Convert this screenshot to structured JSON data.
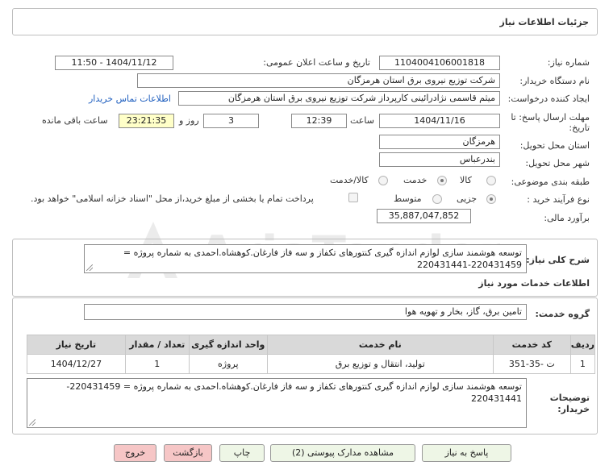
{
  "header": {
    "title": "جزئیات اطلاعات نیاز"
  },
  "form": {
    "need_number_label": "شماره نیاز:",
    "need_number": "1104004106001818",
    "announce_label": "تاریخ و ساعت اعلان عمومی:",
    "announce_value": "1404/11/12 - 11:50",
    "buyer_org_label": "نام دستگاه خریدار:",
    "buyer_org": "شرکت توزیع نیروی برق استان هرمزگان",
    "creator_label": "ایجاد کننده درخواست:",
    "creator": "میثم قاسمی نژادرائینی کارپرداز شرکت توزیع نیروی برق استان هرمزگان",
    "contact_link": "اطلاعات تماس خریدار",
    "deadline_label_1": "مهلت ارسال پاسخ: تا",
    "deadline_label_2": "تاریخ:",
    "deadline_date": "1404/11/16",
    "time_label": "ساعت",
    "deadline_time": "12:39",
    "days_value": "3",
    "days_label": "روز و",
    "remaining_time": "23:21:35",
    "remaining_label": "ساعت باقی مانده",
    "province_label": "استان محل تحویل:",
    "province": "هرمزگان",
    "city_label": "شهر محل تحویل:",
    "city": "بندرعباس",
    "category_label": "طبقه بندی موضوعی:",
    "category_options": [
      "کالا",
      "خدمت",
      "کالا/خدمت"
    ],
    "category_selected": "خدمت",
    "process_label": "نوع فرآیند خرید :",
    "process_options": [
      "جزیی",
      "متوسط"
    ],
    "process_selected": "جزیی",
    "payment_note": "پرداخت تمام یا بخشی از مبلغ خرید،از محل \"اسناد خزانه اسلامی\" خواهد بود.",
    "estimate_label": "برآورد مالی:",
    "estimate": "35,887,047,852"
  },
  "summary": {
    "label": "شرح کلی نیاز:",
    "text": "توسعه هوشمند سازی لوازم اندازه گیری کنتورهای تکفاز و سه فاز  فارغان.کوهشاه.احمدی به شماره پروژه = 220431459-220431441"
  },
  "services": {
    "section_title": "اطلاعات خدمات مورد نیاز",
    "group_label": "گروه خدمت:",
    "group_value": "تامین برق، گاز، بخار و تهویه هوا",
    "columns": [
      "ردیف",
      "کد خدمت",
      "نام خدمت",
      "واحد اندازه گیری",
      "تعداد / مقدار",
      "تاریخ نیاز"
    ],
    "rows": [
      [
        "1",
        "ت -35-351",
        "تولید، انتقال و توزیع برق",
        "پروژه",
        "1",
        "1404/12/27"
      ]
    ]
  },
  "buyer_notes": {
    "label_1": "توضیحات",
    "label_2": "خریدار:",
    "text": "توسعه هوشمند سازی لوازم اندازه گیری کنتورهای تکفاز و سه فاز  فارغان.کوهشاه.احمدی به شماره پروژه = 220431459-220431441"
  },
  "buttons": {
    "reply": "پاسخ به نیاز",
    "attachments": "مشاهده مدارک پیوستی (2)",
    "print": "چاپ",
    "back": "بازگشت",
    "exit": "خروج"
  },
  "colors": {
    "header_border": "#bfbfbf",
    "yellow_field": "#ffffc8",
    "table_header": "#d9d9d9",
    "green_button": "#eef6e6",
    "red_button": "#f6c6c6",
    "link": "#1f5fbf"
  }
}
